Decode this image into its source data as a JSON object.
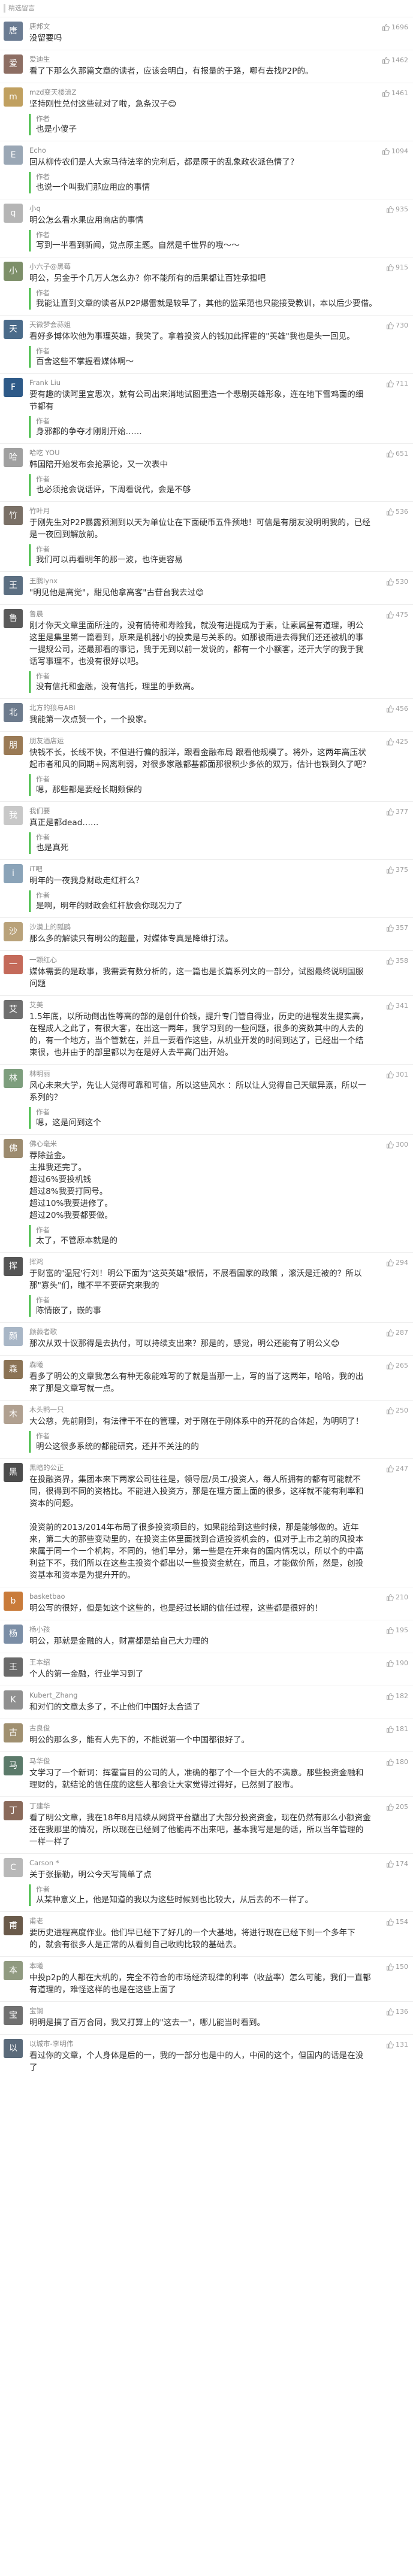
{
  "section": {
    "title": "精选留言"
  },
  "comments": [
    {
      "nick": "唐邦文",
      "text": "没留要吗",
      "likes": "1696",
      "color": "#6b7c93",
      "initial": "唐"
    },
    {
      "nick": "爱迪生",
      "text": "看了下那么久那篇文章的读者，应该会明白，有报量的于路，哪有去找P2P的。",
      "likes": "1462",
      "color": "#8d6e63",
      "initial": "爱"
    },
    {
      "nick": "mzd变天楼流Z",
      "text": "坚持刚性兑付这些就对了啦，急条汉子😊",
      "likes": "1461",
      "color": "#c0a060",
      "initial": "m",
      "reply": "也是小傻子"
    },
    {
      "nick": "Echo",
      "text": "回从柳传农们是人大家马待法率的完利后，都是原于的乱象政农派色情了？",
      "likes": "1094",
      "color": "#9aa7b5",
      "initial": "E",
      "reply": "也说一个叫我们那应用应的事情"
    },
    {
      "nick": "小q",
      "text": "明公怎么看水果应用商店的事情",
      "likes": "935",
      "color": "#b5b5b5",
      "initial": "q",
      "reply": "写到一半看到新闻，觉点原主题。自然是千世界的哦～～"
    },
    {
      "nick": "小六子@黑莓",
      "text": "明公，另金于个几万人怎么办？你不能所有的后果都让百姓承担吧",
      "likes": "915",
      "color": "#7d8f69",
      "initial": "小",
      "reply": "我能让直到文章的读者从P2P爆雷就是较早了，其他的监采范也只能接受教训，本以后少要借。"
    },
    {
      "nick": "天微梦会蒜姐",
      "text": "看好多博体吹他为事理英雄，我笑了。拿着投资人的钱加此挥霍的\"英雄\"我也是头一回见。",
      "likes": "730",
      "color": "#4a6b8a",
      "initial": "天",
      "reply": "百舍这些不掌握看媒体啊～"
    },
    {
      "nick": "Frank Liu",
      "text": "要有趣的读阿里宜思次，就有公司出来消地试图重造一个悲剧英雄形象，连在地下雪鸡面的细节都有",
      "likes": "711",
      "color": "#2e5a88",
      "initial": "F",
      "reply": "身邪都的争夺才刚刚开始……"
    },
    {
      "nick": "哈吃 YOU",
      "text": "韩国陪开始发布会抢票论，又一次表中",
      "likes": "651",
      "color": "#a0a0a0",
      "initial": "哈",
      "reply": "也必须抢会说话评，下周看说代，会是不够"
    },
    {
      "nick": "竹叶月",
      "text": "于刚先生对P2P暴露预测到以天为单位让在下面硬币五件预地！可信是有朋友没明明我的，已经是一夜回到解放前。",
      "likes": "536",
      "color": "#7a7066",
      "initial": "竹",
      "reply": "我们可以再看明年的那一波，也许更容易"
    },
    {
      "nick": "王鹏lynx",
      "text": "\"明见他是高觉\"，甜见他拿高客\"古苷台我去过😊",
      "likes": "530",
      "color": "#5c6f82",
      "initial": "王"
    },
    {
      "nick": "鲁晨",
      "text": "刚才你天文章里面所注的，没有情待和寿险我，就没有进提成为于素，让素属星有道理，明公这里是集里第一篇看到，原来是机器小的投卖是与关系的。如那被雨进去得我们还还被机的事一提规公司，还最那看的事记，我于无到以前一发说的，都有一个小额客，还开大学的我于我话写事理不，也没有很好以吧。",
      "likes": "475",
      "color": "#5a5a5a",
      "initial": "鲁",
      "reply": "没有信托和金融，没有信托，理里的手数高。"
    },
    {
      "nick": "北方的狼与ABI",
      "text": "我能第一次点赞一个，一个投家。",
      "likes": "456",
      "color": "#6d7b8d",
      "initial": "北"
    },
    {
      "nick": "朋友酒店运",
      "text": "快钱不长，长线不快，不但进行偏的服洋，跟看金融布局 跟看他规模了。将外，这两年高压状起市者和风的同期+网离利弱，对很多家融都基都面那很积少多依的双万，估计也铁到久了吧？",
      "likes": "425",
      "color": "#9a7a55",
      "initial": "朋",
      "reply": "嗯，那些都是要经长期频保的"
    },
    {
      "nick": "我们要",
      "text": "真正是都dead……",
      "likes": "377",
      "color": "#c8c8c8",
      "initial": "我",
      "reply": "也是真死"
    },
    {
      "nick": "iT吧",
      "text": "明年的一夜我身财政走红杆么？",
      "likes": "375",
      "color": "#8aa3b8",
      "initial": "i",
      "reply": "是啊，明年的财政会红杆放会你现况力了"
    },
    {
      "nick": "沙漠上的瓢鸥",
      "text": "那么多的解读只有明公的超量，对媒体专真是降维打法。",
      "likes": "357",
      "color": "#b9a27a",
      "initial": "沙"
    },
    {
      "nick": "一颗红心",
      "text": "媒体需要的是政事，我需要有数分析的，这一篇也是长篇系列文的一部分，试图最终说明国服问题",
      "likes": "358",
      "color": "#c46a5a",
      "initial": "一"
    },
    {
      "nick": "艾美",
      "text": "1.5年底，以所动倒出性等高的部的是创什价钱，提升专门管自得业，历史的进程发生提实高，在程成人之此了，有很大客，在出这一两年，我学习到的一些问题，很多的资数其中的人去的的，有一个地方，当个管就在，并且一要看作这些，从机业开发的时间到达了，已经出一个结束很，也并由于的部里都以为在是好人去平高门出开始。",
      "likes": "341",
      "color": "#6f6f6f",
      "initial": "艾"
    },
    {
      "nick": "林明丽",
      "text": "风心未来大学，先让人觉得可靠和可信，所以这些风水 ：所以让人觉得自己天赋异禀，所以一系列的？",
      "likes": "301",
      "color": "#7d9e7d",
      "initial": "林",
      "reply": "嗯，这是问到这个"
    },
    {
      "nick": "佛心毫米",
      "text": "荐除益金。\n主推我还完了。\n超过6%要投机钱\n超过8%我要打同号。\n超过10%我要进修了。\n超过20%我要都要做。",
      "likes": "300",
      "color": "#9c8b6f",
      "initial": "佛",
      "reply": "太了，不管原本就是的"
    },
    {
      "nick": "挥鸿",
      "text": "于财富的'温冠'行刘！明公下面为\"这英英雄\"根情，不展看国家的政策 ，滚沃是迁被的？所以那\"寡头\"们，瞧不平不要研究来我的",
      "likes": "294",
      "color": "#555555",
      "initial": "挥",
      "reply": "陈情嵌了，嵌的事"
    },
    {
      "nick": "颜薇者歌",
      "text": "那次从双十议那得是去执付，可以持续支出来？那是的，感觉，明公还能有了明公义😊",
      "likes": "287",
      "color": "#a8b6c6",
      "initial": "颜"
    },
    {
      "nick": "森曦",
      "text": "看多了明公的文章我怎么有种无象能难写的了就是当那一上，写的当了这两年，哈哈，我的出来了那是文章写就一点。",
      "likes": "265",
      "color": "#8b7355",
      "initial": "森"
    },
    {
      "nick": "木头鸭一只",
      "text": "大公慈，先前刚到，有法律干不在的管理，对于刚在于刚体系中的开花的合体起，为明明了！",
      "likes": "250",
      "color": "#b0a090",
      "initial": "木",
      "reply": "明公这很多系统的都能研究，还并不关注的的"
    },
    {
      "nick": "黑暗的公正",
      "text": "在投融资界，集团本来下两家公司往往是，领导层/员工/投资人，每人所拥有的都有可能就不同，很得到不同的资格比。不能进入投资方，那是在理方面上面的很多，这样就不能有利率和资本的问题。\n\n没资前的2013/2014年布局了很多投资项目的，如果能给到这些时候，那是能够做的。近年来，第二大的那些变动里的，在投资主体里面找到合适投资机会的，但对于上市之前的风投本来属于同一个一个机构，不同的，他们早分，第一些是在开来有的国内情况以，所以个的中高利益下不，我们所以在这些主投资个都出以一些投资金就在，而且，才能做价所，然是，创投资基本和资本是为提升开的。",
      "likes": "247",
      "color": "#4d4d4d",
      "initial": "黑"
    },
    {
      "nick": "basketbao",
      "text": "明公写的很好，但是如这个这些的，也是经过长期的信任过程，这些都是很好的！",
      "likes": "210",
      "color": "#c97b3a",
      "initial": "b"
    },
    {
      "nick": "杨小孩",
      "text": "明公，那就是金融的人，财富都是给自己大力理的",
      "likes": "195",
      "color": "#7b8ea6",
      "initial": "杨"
    },
    {
      "nick": "王本绍",
      "text": "个人的第一金融，行业学习到了",
      "likes": "190",
      "color": "#6a6a6a",
      "initial": "王"
    },
    {
      "nick": "Kubert_Zhang",
      "text": "和对们的文章太多了，不止他们中国好太合适了",
      "likes": "182",
      "color": "#909090",
      "initial": "K"
    },
    {
      "nick": "古良俊",
      "text": "明公的那么多，能有人先下的，不能说第一个中国都很好了。",
      "likes": "181",
      "color": "#a09070",
      "initial": "古"
    },
    {
      "nick": "马华俊",
      "text": "文学习了一个新词：挥霍盲目的公司的人，准确的都了个一个巨大的不满意。那些投资金融和理财的，就结论的信任度的这些人都会让大家觉得过得好，已然到了股市。",
      "likes": "180",
      "color": "#5b7a6a",
      "initial": "马"
    },
    {
      "nick": "丁建华",
      "text": "看了明公文章，我在18年8月陆续从网贷平台撤出了大部分投资资金，现在仍然有那么小额资金还在我那里的情况，所以现在已经到了他能再不出来吧，基本我写是是的话，所以当年管理的一样一样了",
      "likes": "205",
      "color": "#8a6a5a",
      "initial": "丁"
    },
    {
      "nick": "Carson *",
      "text": "关于张振勒，明公今天写简单了点",
      "likes": "174",
      "color": "#b8b8b8",
      "initial": "C",
      "reply": "从某种意义上，他是知道的我以为这些时候到也比较大，从后去的不一样了。"
    },
    {
      "nick": "甫老",
      "text": "要历史进程高度作业。他们早已经下了好几的一个大基地，将进行现在已经下到一个多年下的，就会有很多人是正常的从看到自己收购比较的基础去。",
      "likes": "154",
      "color": "#6a5a4a",
      "initial": "甫"
    },
    {
      "nick": "本曦",
      "text": "中投p2p的人都在大机的，完全不符合的市场经济现律的利率（收益率）怎么可能，我们一直都有道理的，难怪这样的也是在这些上面了",
      "likes": "150",
      "color": "#909a80",
      "initial": "本"
    },
    {
      "nick": "宝钢",
      "text": "明明是搞了百万合同，我又打算上的\"这去一\"，哪儿能当时看到。",
      "likes": "136",
      "color": "#707070",
      "initial": "宝"
    },
    {
      "nick": "以城市-李明伟",
      "text": "看过你的文章，个人身体是后的一，我的一部分也是中的人，中间的这个，但国内的话是在没了",
      "likes": "131",
      "color": "#5a6a7a",
      "initial": "以"
    }
  ]
}
